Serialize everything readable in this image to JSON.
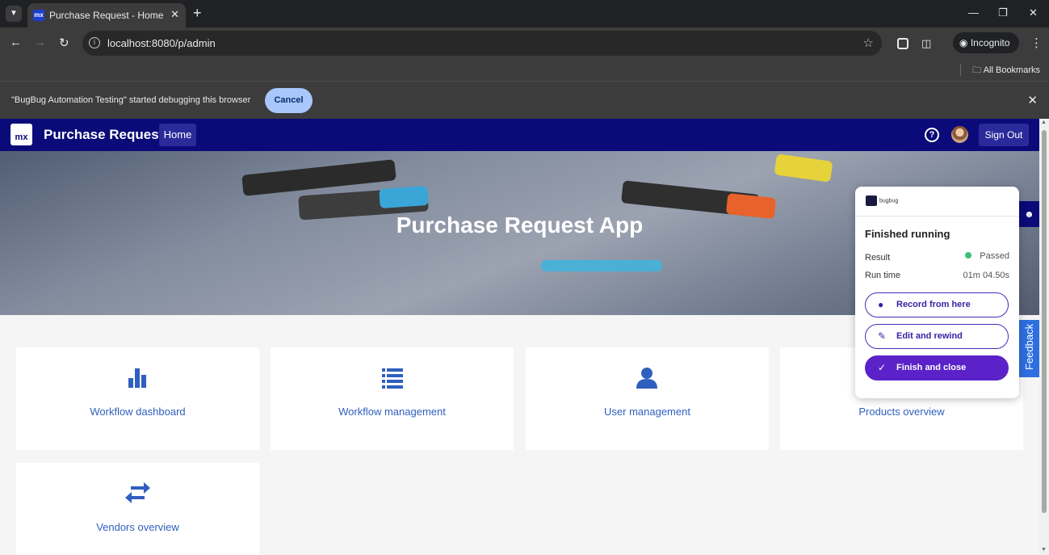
{
  "browser": {
    "tab_title": "Purchase Request - Homepage",
    "favicon_text": "mx",
    "url": "localhost:8080/p/admin",
    "incognito_label": "Incognito",
    "bookmarks_label": "All Bookmarks",
    "debug_message": "\"BugBug Automation Testing\" started debugging this browser",
    "debug_cancel": "Cancel"
  },
  "app": {
    "logo_text": "mx",
    "title": "Purchase Request",
    "home_label": "Home",
    "help_glyph": "?",
    "sign_out_label": "Sign Out",
    "hero_title": "Purchase Request App"
  },
  "cards": [
    {
      "label": "Workflow dashboard",
      "icon": "bar-chart-icon"
    },
    {
      "label": "Workflow management",
      "icon": "list-icon"
    },
    {
      "label": "User management",
      "icon": "user-icon"
    },
    {
      "label": "Products overview",
      "icon": "box-icon"
    },
    {
      "label": "Vendors overview",
      "icon": "swap-arrows-icon"
    }
  ],
  "bugbug": {
    "brand": "bugbug",
    "heading": "Finished running",
    "result_label": "Result",
    "result_value": "Passed",
    "result_color": "#3bbf7a",
    "runtime_label": "Run time",
    "runtime_value": "01m 04.50s",
    "record_label": "Record from here",
    "edit_label": "Edit and rewind",
    "finish_label": "Finish and close"
  },
  "feedback_label": "Feedback",
  "colors": {
    "appbar": "#0a0a78",
    "link": "#2f5fbf",
    "primary_button": "#5a22c8"
  }
}
